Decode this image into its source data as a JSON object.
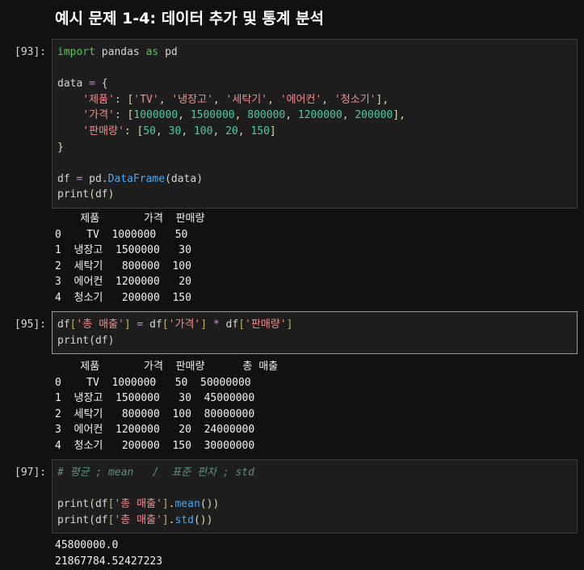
{
  "notebook": {
    "title": "예시 문제 1-4: 데이터 추가 및 통계 분석",
    "cells": [
      {
        "prompt": "[93]:",
        "selected": false,
        "source_lines": [
          "import pandas as pd",
          "",
          "data = {",
          "    '제품': ['TV', '냉장고', '세탁기', '에어컨', '청소기'],",
          "    '가격': [1000000, 1500000, 800000, 1200000, 200000],",
          "    '판매량': [50, 30, 100, 20, 150]",
          "}",
          "",
          "df = pd.DataFrame(data)",
          "print(df)"
        ],
        "output_lines": [
          "    제품       가격  판매량",
          "0    TV  1000000   50",
          "1  냉장고  1500000   30",
          "2  세탁기   800000  100",
          "3  에어컨  1200000   20",
          "4  청소기   200000  150"
        ]
      },
      {
        "prompt": "[95]:",
        "selected": true,
        "source_lines": [
          "df['총 매출'] = df['가격'] * df['판매량']",
          "print(df)"
        ],
        "output_lines": [
          "    제품       가격  판매량      총 매출",
          "0    TV  1000000   50  50000000",
          "1  냉장고  1500000   30  45000000",
          "2  세탁기   800000  100  80000000",
          "3  에어컨  1200000   20  24000000",
          "4  청소기   200000  150  30000000"
        ]
      },
      {
        "prompt": "[97]:",
        "selected": false,
        "source_lines": [
          "# 평균 ; mean   /  표준 편차 ; std",
          "",
          "print(df['총 매출'].mean())",
          "print(df['총 매출'].std())"
        ],
        "output_lines": [
          "45800000.0",
          "21867784.52427223"
        ]
      }
    ]
  },
  "colors": {
    "background": "#111111",
    "cell_background": "#1e1e1e",
    "cell_border": "#3a3a3a",
    "cell_border_selected": "#9a9a9a",
    "prompt_text": "#d8d8d8",
    "title_text": "#ffffff",
    "keyword": "#4ec94e",
    "string": "#f08c8c",
    "number": "#4ec9a0",
    "operator": "#c586e8",
    "function": "#4fa6e8",
    "comment": "#5a8f84",
    "output_text": "#f2f2f2"
  }
}
